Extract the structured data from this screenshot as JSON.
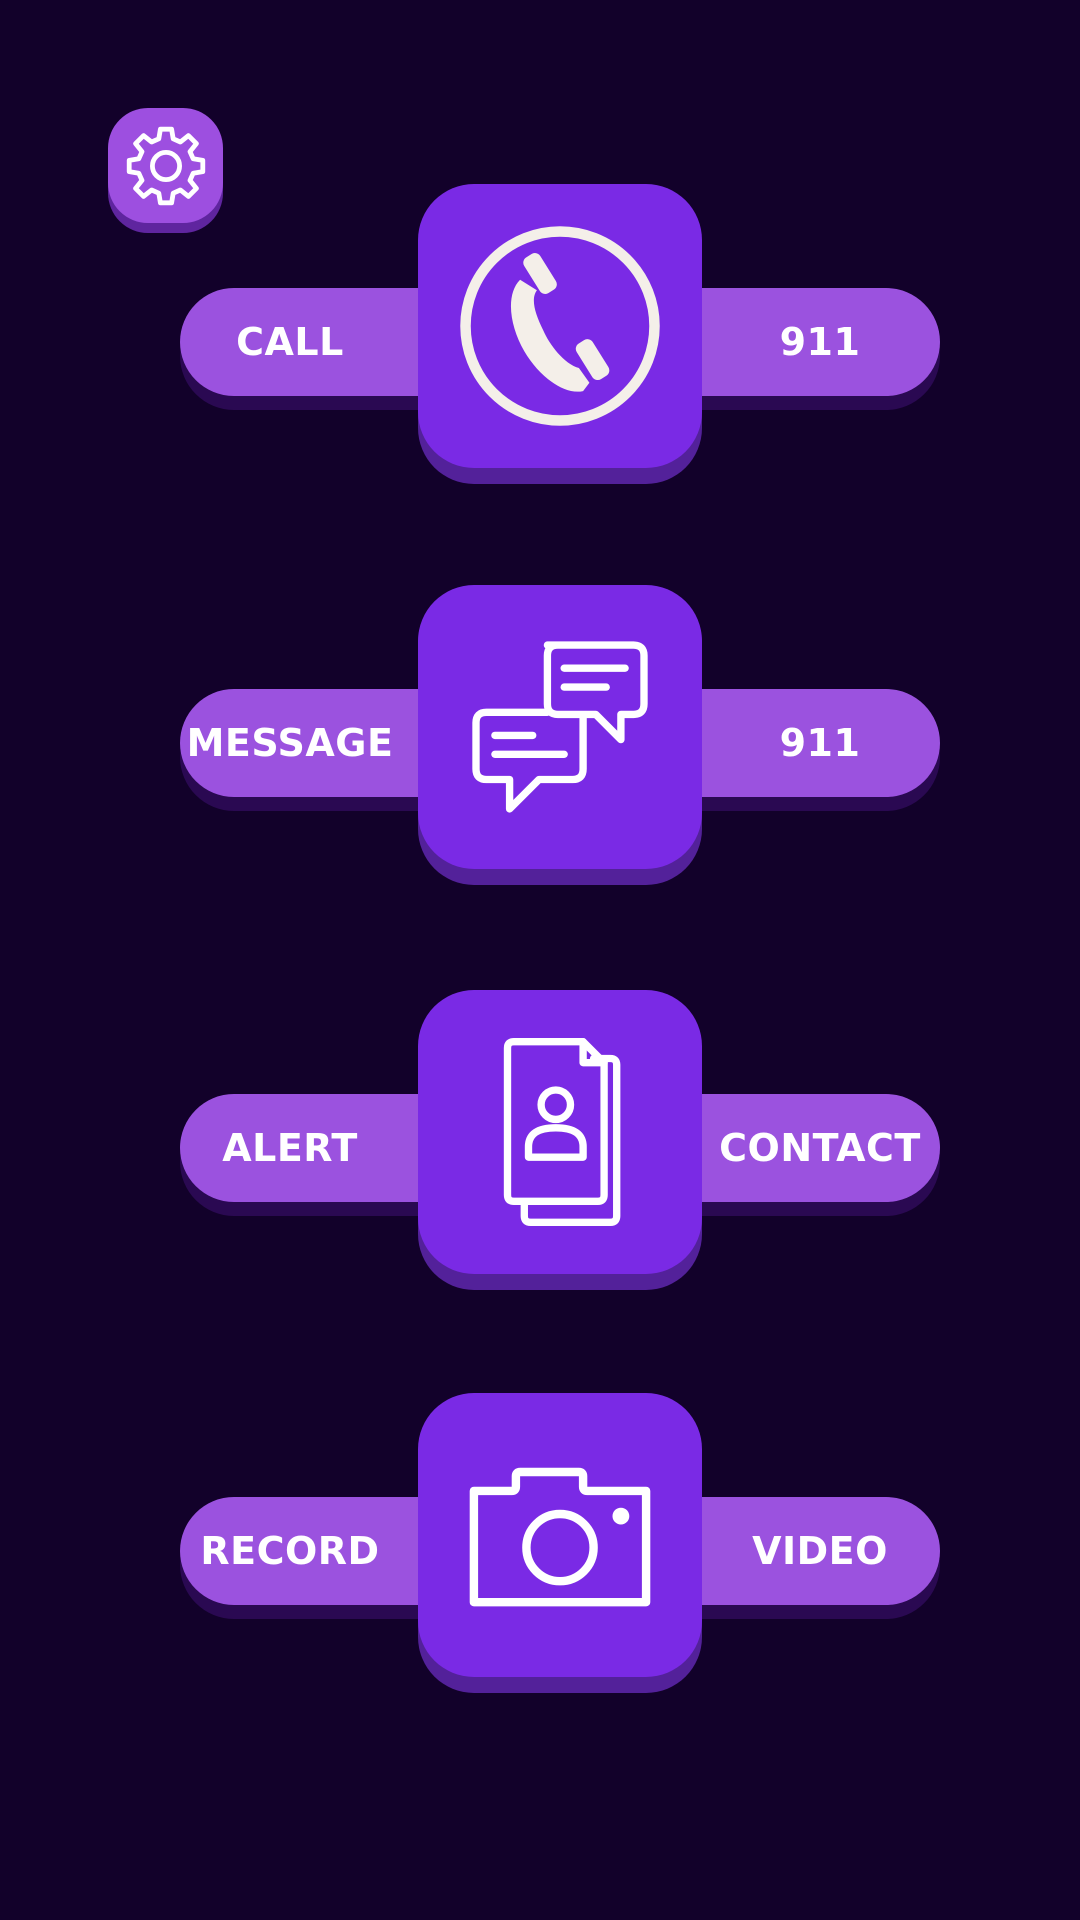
{
  "settings": {
    "icon": "gear-icon"
  },
  "actions": [
    {
      "left_label": "CALL",
      "right_label": "911",
      "icon": "phone-icon"
    },
    {
      "left_label": "MESSAGE",
      "right_label": "911",
      "icon": "chat-bubbles-icon"
    },
    {
      "left_label": "ALERT",
      "right_label": "CONTACT",
      "icon": "contact-card-icon"
    },
    {
      "left_label": "RECORD",
      "right_label": "VIDEO",
      "icon": "camera-icon"
    }
  ],
  "colors": {
    "background": "#12012a",
    "tile": "#7a2ae5",
    "pill": "#9b52df",
    "settings": "#9d4fe0"
  }
}
